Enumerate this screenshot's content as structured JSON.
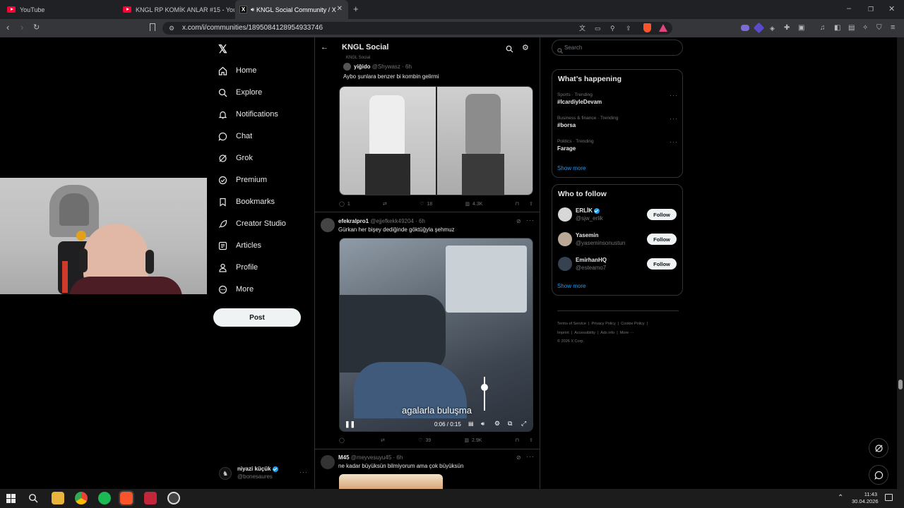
{
  "browser": {
    "tabs": [
      {
        "title": "YouTube",
        "active": false
      },
      {
        "title": "KNGL RP KOMİK ANLAR #15 - YouTu",
        "active": false
      },
      {
        "title": "KNGL Social Community / X",
        "active": true
      }
    ],
    "url": "x.com/i/communities/1895084128954933746"
  },
  "nav": {
    "items": [
      {
        "label": "Home",
        "icon": "home-icon"
      },
      {
        "label": "Explore",
        "icon": "search-icon"
      },
      {
        "label": "Notifications",
        "icon": "bell-icon"
      },
      {
        "label": "Chat",
        "icon": "chat-icon"
      },
      {
        "label": "Grok",
        "icon": "grok-icon"
      },
      {
        "label": "Premium",
        "icon": "premium-icon"
      },
      {
        "label": "Bookmarks",
        "icon": "bookmark-icon"
      },
      {
        "label": "Creator Studio",
        "icon": "rocket-icon"
      },
      {
        "label": "Articles",
        "icon": "article-icon"
      },
      {
        "label": "Profile",
        "icon": "person-icon"
      },
      {
        "label": "More",
        "icon": "more-circle-icon"
      }
    ],
    "post_label": "Post",
    "account": {
      "name": "niyazi küçük",
      "handle": "@bonesaures"
    }
  },
  "header": {
    "title": "KNGL Social"
  },
  "feed": {
    "quoted_community": "KNGL Social",
    "post1": {
      "author": "yiğido",
      "handle": "@Shywasz",
      "time": "· 6h",
      "text": "Aybo şunlara benzer bi kombin gelirmi",
      "replies": "1",
      "reposts": "",
      "likes": "18",
      "views": "4.3K"
    },
    "post2": {
      "author": "efekralpro1",
      "handle": "@ejjefkekk49204",
      "time": "· 6h",
      "text": "Gürkan her bişey dediğinde göktüğyla şehmuz",
      "caption": "agalarla buluşma",
      "time_display": "0:06 / 0:15",
      "replies": "",
      "reposts": "",
      "likes": "39",
      "views": "2.9K"
    },
    "post3": {
      "author": "M45",
      "handle": "@meyvesuyu45",
      "time": "· 6h",
      "text": "ne kadar büyüksün bilmiyorum ama çok büyüksün"
    }
  },
  "right": {
    "search_placeholder": "Search",
    "happening_title": "What’s happening",
    "trends": [
      {
        "meta": "Sports · Trending",
        "name": "#IcardiyleDevam"
      },
      {
        "meta": "Business & finance · Trending",
        "name": "#borsa"
      },
      {
        "meta": "Politics · Trending",
        "name": "Farage"
      }
    ],
    "show_more": "Show more",
    "follow_title": "Who to follow",
    "follow": [
      {
        "name": "ERLİK",
        "handle": "@sjw_erlik",
        "verified": true,
        "button": "Follow"
      },
      {
        "name": "Yasemin",
        "handle": "@yaseminsonustun",
        "verified": false,
        "button": "Follow"
      },
      {
        "name": "EmirhanHQ",
        "handle": "@esteamo7",
        "verified": false,
        "button": "Follow"
      }
    ],
    "show_more2": "Show more",
    "footer": {
      "l1": "Terms of Service",
      "l2": "Privacy Policy",
      "l3": "Cookie Policy",
      "l4": "Imprint",
      "l5": "Accessibility",
      "l6": "Ads info",
      "l7": "More ···",
      "copyright": "© 2026 X Corp."
    }
  },
  "taskbar": {
    "time": "11:43",
    "date": "30.04.2026"
  }
}
